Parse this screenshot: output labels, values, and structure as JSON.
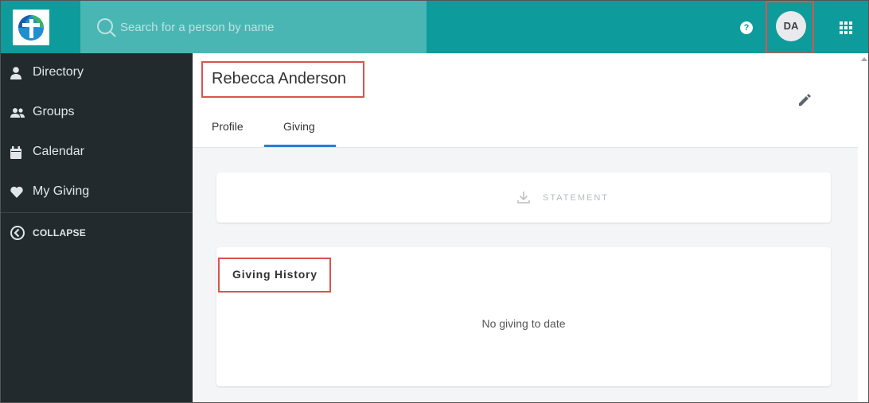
{
  "header": {
    "logo_icon": "church-cross-logo-icon",
    "search": {
      "placeholder": "Search for a person by name",
      "value": ""
    },
    "help_label": "?",
    "avatar_initials": "DA",
    "apps_icon": "grid-apps-icon",
    "accent_color": "#0d9b9b"
  },
  "sidebar": {
    "items": [
      {
        "label": "Directory",
        "icon": "person-icon"
      },
      {
        "label": "Groups",
        "icon": "group-icon"
      },
      {
        "label": "Calendar",
        "icon": "calendar-icon"
      },
      {
        "label": "My Giving",
        "icon": "heart-icon"
      }
    ],
    "collapse_label": "COLLAPSE"
  },
  "person": {
    "name": "Rebecca Anderson",
    "tabs": [
      {
        "label": "Profile",
        "active": false
      },
      {
        "label": "Giving",
        "active": true
      }
    ]
  },
  "giving": {
    "statement_label": "STATEMENT",
    "history_title": "Giving History",
    "empty_message": "No giving to date"
  },
  "colors": {
    "highlight_box": "#d9534f",
    "tab_active": "#2b7bd9",
    "sidebar_bg": "#222a2e"
  }
}
